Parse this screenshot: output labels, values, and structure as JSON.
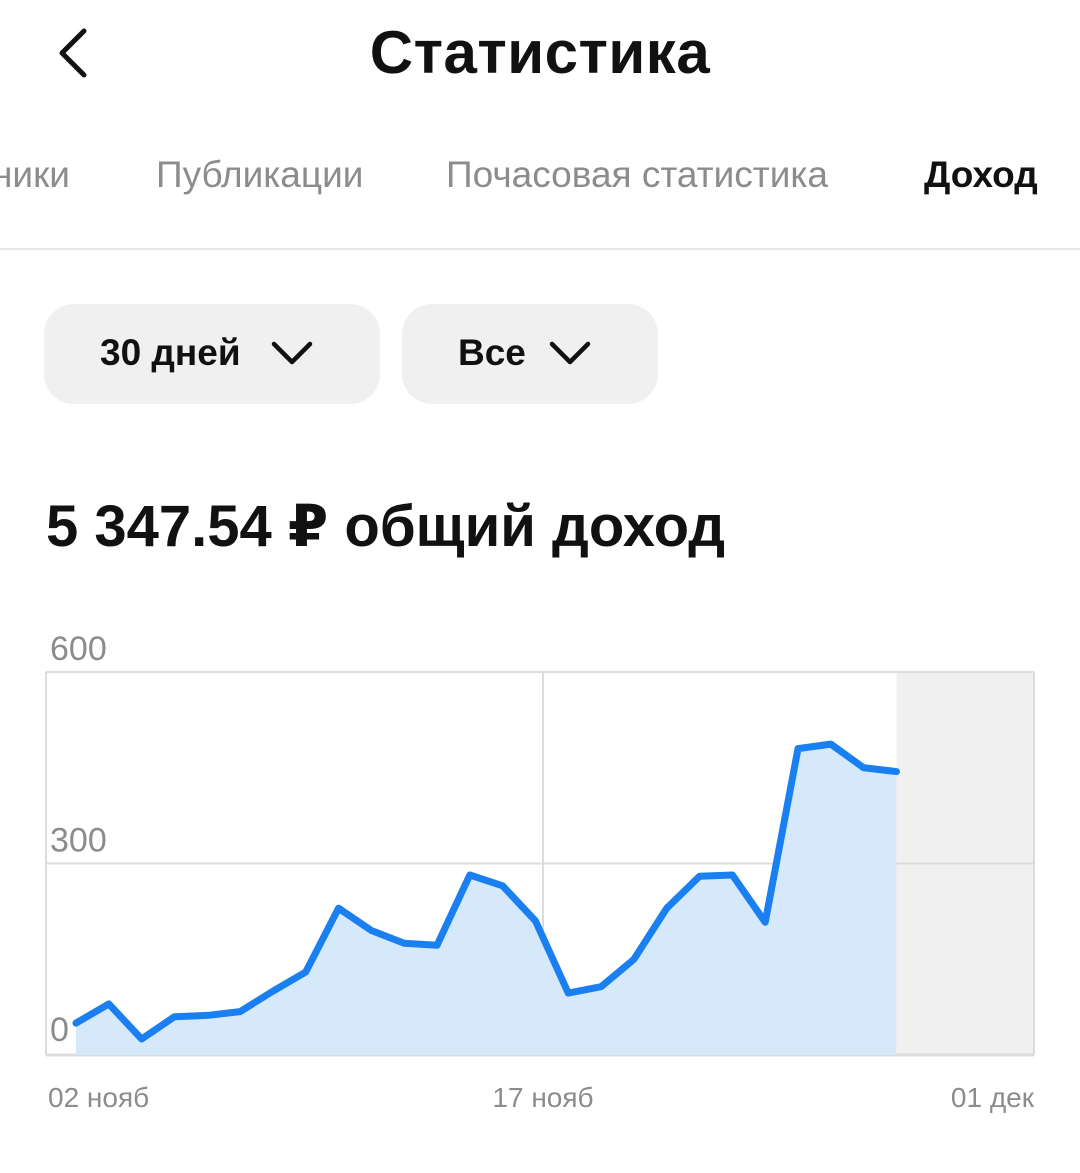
{
  "header": {
    "title": "Статистика",
    "back_icon": "chevron-left-icon"
  },
  "tabs": [
    {
      "label": "ники",
      "active": false
    },
    {
      "label": "Публикации",
      "active": false
    },
    {
      "label": "Почасовая статистика",
      "active": false
    },
    {
      "label": "Доход",
      "active": true
    }
  ],
  "filters": {
    "period": {
      "label": "30 дней",
      "icon": "chevron-down-icon"
    },
    "type": {
      "label": "Все",
      "icon": "chevron-down-icon"
    }
  },
  "summary": {
    "amount": "5 347.54",
    "currency": "₽",
    "caption": "общий доход"
  },
  "colors": {
    "line": "#1a7ff0",
    "area": "#d6e9fb",
    "grid": "#dcdcdc",
    "future_band": "#f0f0f0",
    "tab_inactive": "#8c8c8c"
  },
  "chart_data": {
    "type": "area",
    "x": [
      "02 нояб",
      "03 нояб",
      "04 нояб",
      "05 нояб",
      "06 нояб",
      "07 нояб",
      "08 нояб",
      "09 нояб",
      "10 нояб",
      "11 нояб",
      "12 нояб",
      "13 нояб",
      "14 нояб",
      "15 нояб",
      "16 нояб",
      "17 нояб",
      "18 нояб",
      "19 нояб",
      "20 нояб",
      "21 нояб",
      "22 нояб",
      "23 нояб",
      "24 нояб",
      "25 нояб",
      "26 нояб",
      "27 нояб",
      "28 нояб",
      "29 нояб"
    ],
    "values": [
      50,
      80,
      25,
      60,
      62,
      68,
      100,
      130,
      230,
      195,
      175,
      172,
      282,
      265,
      210,
      97,
      107,
      150,
      230,
      280,
      282,
      208,
      480,
      487,
      450,
      444
    ],
    "x_ticks": [
      "02 нояб",
      "17 нояб",
      "01 дек"
    ],
    "y_ticks": [
      "600",
      "300",
      "0"
    ],
    "ylim": [
      0,
      600
    ],
    "title": "",
    "xlabel": "",
    "ylabel": "",
    "grid": true,
    "future_region": true
  }
}
